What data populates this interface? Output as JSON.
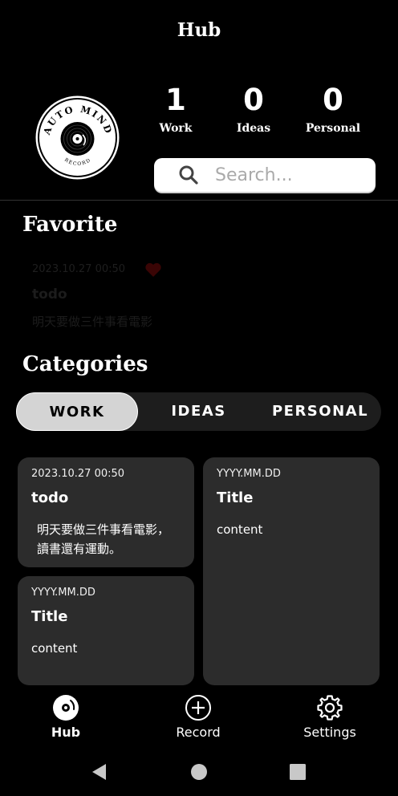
{
  "app": {
    "title": "Hub"
  },
  "logo": {
    "top_text": "AUTO MIND",
    "bottom_text": "RECORD"
  },
  "stats": [
    {
      "count": "1",
      "label": "Work"
    },
    {
      "count": "0",
      "label": "Ideas"
    },
    {
      "count": "0",
      "label": "Personal"
    }
  ],
  "search": {
    "placeholder": "Search...",
    "value": ""
  },
  "favorite": {
    "title": "Favorite",
    "card": {
      "date": "2023.10.27 00:50",
      "title": "todo",
      "content": "明天要做三件事看電影",
      "icon": "heart-icon"
    }
  },
  "categories": {
    "title": "Categories",
    "tabs": [
      "WORK",
      "IDEAS",
      "PERSONAL"
    ],
    "active_tab": "WORK"
  },
  "cards": [
    {
      "date": "2023.10.27 00:50",
      "title": "todo",
      "content_line1": "明天要做三件事看電影，",
      "content_line2": "讀書還有運動。"
    },
    {
      "date": "YYYY.MM.DD",
      "title": "Title",
      "content": "content"
    },
    {
      "date": "YYYY.MM.DD",
      "title": "Title",
      "content": "content"
    }
  ],
  "bottom_nav": [
    {
      "label": "Hub",
      "icon": "vinyl-record-icon",
      "active": true
    },
    {
      "label": "Record",
      "icon": "plus-circle-icon",
      "active": false
    },
    {
      "label": "Settings",
      "icon": "gear-icon",
      "active": false
    }
  ],
  "system_nav": [
    "back-icon",
    "home-icon",
    "recents-icon"
  ],
  "colors": {
    "background": "#000000",
    "card": "#2c2c2c",
    "tab_active": "#d4d4d4",
    "tab_bar": "#1d1d1d",
    "favorite_heart": "#3a0505"
  }
}
